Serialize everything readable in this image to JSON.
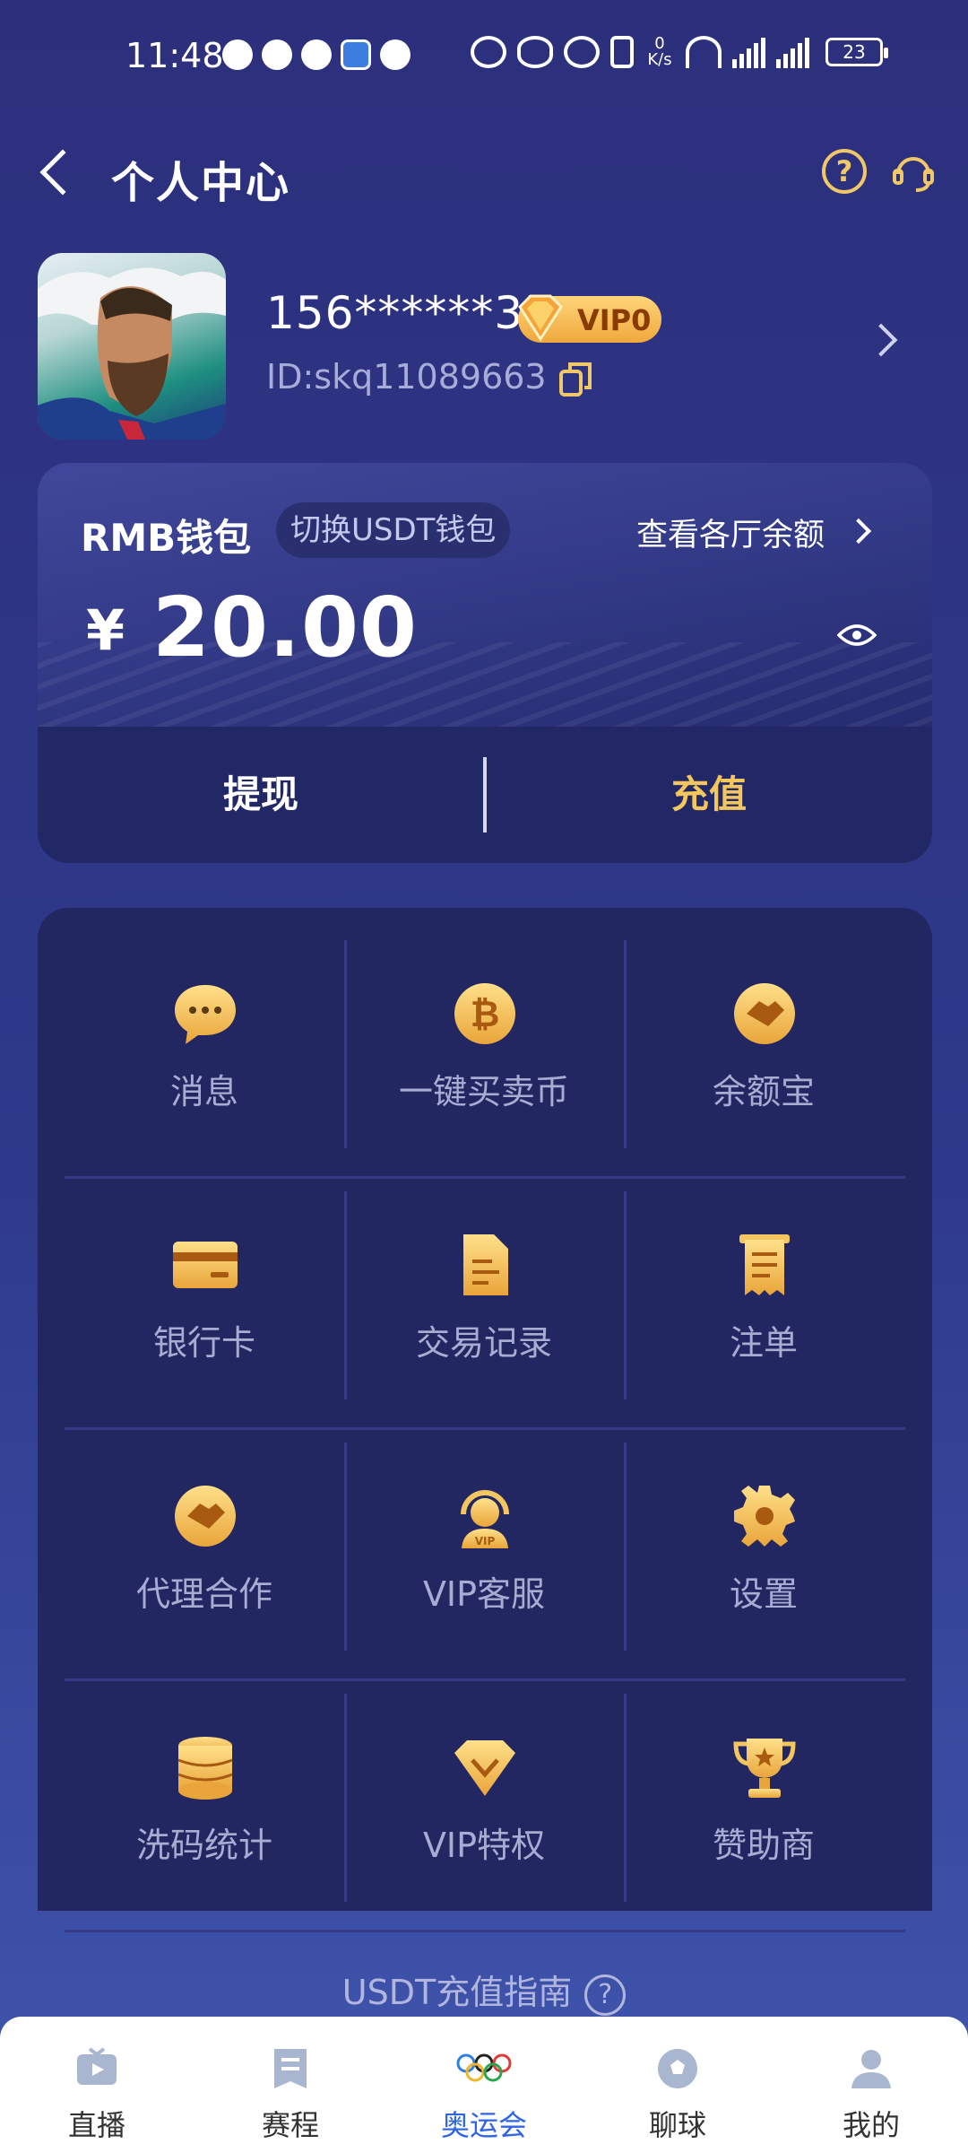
{
  "status_bar": {
    "time": "11:48",
    "net_speed": "0\nK/s",
    "battery": "23"
  },
  "header": {
    "title": "个人中心"
  },
  "profile": {
    "phone": "156******35",
    "vip": "VIP0",
    "id_text": "ID:skq11089663"
  },
  "wallet": {
    "name": "RMB钱包",
    "switch_label": "切换USDT钱包",
    "check_balance_label": "查看各厅余额",
    "currency_symbol": "¥",
    "balance": "20.00",
    "withdraw_label": "提现",
    "recharge_label": "充值"
  },
  "menu": {
    "rows": [
      [
        {
          "label": "消息",
          "icon": "message-icon"
        },
        {
          "label": "一键买卖币",
          "icon": "bitcoin-icon"
        },
        {
          "label": "余额宝",
          "icon": "handshake-icon"
        }
      ],
      [
        {
          "label": "银行卡",
          "icon": "bank-card-icon"
        },
        {
          "label": "交易记录",
          "icon": "document-icon"
        },
        {
          "label": "注单",
          "icon": "receipt-icon"
        }
      ],
      [
        {
          "label": "代理合作",
          "icon": "handshake-icon"
        },
        {
          "label": "VIP客服",
          "icon": "vip-support-icon"
        },
        {
          "label": "设置",
          "icon": "gear-icon"
        }
      ],
      [
        {
          "label": "洗码统计",
          "icon": "coin-stack-icon"
        },
        {
          "label": "VIP特权",
          "icon": "diamond-icon"
        },
        {
          "label": "赞助商",
          "icon": "trophy-icon"
        }
      ]
    ]
  },
  "guide": {
    "label": "USDT充值指南"
  },
  "bottom_nav": [
    {
      "label": "直播",
      "icon": "live-tv-icon"
    },
    {
      "label": "赛程",
      "icon": "schedule-icon"
    },
    {
      "label": "奥运会",
      "icon": "olympic-rings-icon",
      "active": true
    },
    {
      "label": "聊球",
      "icon": "football-icon"
    },
    {
      "label": "我的",
      "icon": "user-icon"
    }
  ],
  "colors": {
    "accent_gold": "#f3c65f",
    "active_blue": "#2e64e6",
    "card_bg": "#222661"
  }
}
